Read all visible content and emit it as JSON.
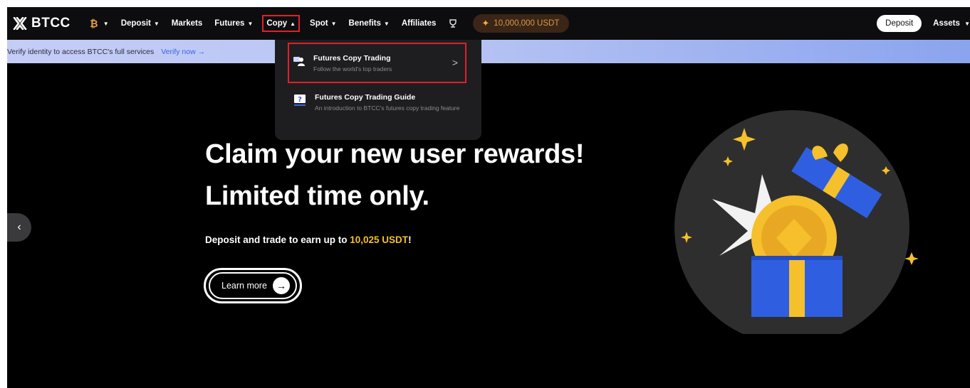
{
  "brand": {
    "name": "BTCC"
  },
  "nav": {
    "items": [
      {
        "label": "Deposit",
        "has_caret": true
      },
      {
        "label": "Markets",
        "has_caret": false
      },
      {
        "label": "Futures",
        "has_caret": true
      },
      {
        "label": "Copy",
        "has_caret": true,
        "open": true
      },
      {
        "label": "Spot",
        "has_caret": true
      },
      {
        "label": "Benefits",
        "has_caret": true
      },
      {
        "label": "Affiliates",
        "has_caret": false
      }
    ],
    "caret_down": "▼",
    "caret_up": "▲",
    "promo": "10,000,000 USDT",
    "deposit_button": "Deposit",
    "assets": "Assets"
  },
  "verify_bar": {
    "text": "Verify identity to access BTCC's full services",
    "link": "Verify now →"
  },
  "copy_menu": {
    "items": [
      {
        "title": "Futures Copy Trading",
        "desc": "Follow the world's top traders",
        "icon": "trader-icon"
      },
      {
        "title": "Futures Copy Trading Guide",
        "desc": "An introduction to BTCC's futures copy trading feature",
        "icon": "guide-icon"
      }
    ]
  },
  "hero": {
    "title_line1": "Claim your new user rewards!",
    "title_line2": "Limited time only.",
    "sub_prefix": "Deposit and trade to earn up to ",
    "sub_amount": "10,025 USDT",
    "sub_suffix": "!",
    "button": "Learn more"
  },
  "colors": {
    "accent_yellow": "#f5c02b",
    "highlight_red": "#e0202a",
    "link_blue": "#3c64e4",
    "gift_blue": "#2f5fe0"
  }
}
